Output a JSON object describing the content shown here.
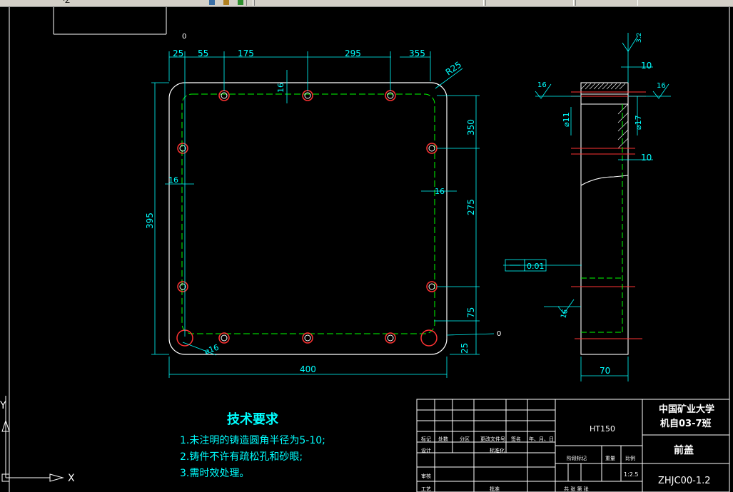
{
  "toolbar": {
    "partial_label": "·Z"
  },
  "origin_labels": {
    "top_zero": "0",
    "right_zero": "0"
  },
  "dimensions": {
    "d25_top": "25",
    "d55": "55",
    "d175": "175",
    "d295": "295",
    "d355": "355",
    "r25": "R25",
    "d16_top": "16",
    "d350": "350",
    "d16_left": "16",
    "d16_right": "16",
    "d275": "275",
    "d395": "395",
    "d75": "75",
    "d25_right": "25",
    "phi16": "⌀16",
    "d400": "400",
    "side_10_top": "10",
    "side_10_mid": "10",
    "side_phi11": "⌀11",
    "side_phi17": "⌀17",
    "side_70": "70",
    "rough_16_a": "16",
    "rough_16_b": "16",
    "rough_16_c": "16",
    "rough_32": "3.2",
    "flatness_tol": "0.01"
  },
  "tech_requirements": {
    "title": "技术要求",
    "items": [
      "1.未注明的铸造圆角半径为5-10;",
      "2.铸件不许有疏松孔和砂眼;",
      "3.需时效处理。"
    ]
  },
  "title_block": {
    "material": "HT150",
    "university": "中国矿业大学",
    "class": "机自03-7班",
    "part_name": "前盖",
    "drawing_no": "ZHJC00-1.2",
    "scale": "1:2.5",
    "row_headers": [
      "标记",
      "处数",
      "分区",
      "更改文件号",
      "签名",
      "年、月、日"
    ],
    "designer": "设计",
    "standardization": "标准化",
    "stage_label": "阶段标记",
    "weight_label": "重量",
    "scale_label": "比例",
    "review": "审核",
    "process": "工艺",
    "approve": "批准",
    "sheets": "共 张 第 张"
  },
  "ucs": {
    "x_label": "X",
    "y_label": "Y"
  },
  "colors": {
    "background": "#000000",
    "outline": "#ffffff",
    "dimension": "#00ffff",
    "centerline": "#00ff00",
    "hole": "#ff3333",
    "text_yellow": "#ffff00"
  }
}
